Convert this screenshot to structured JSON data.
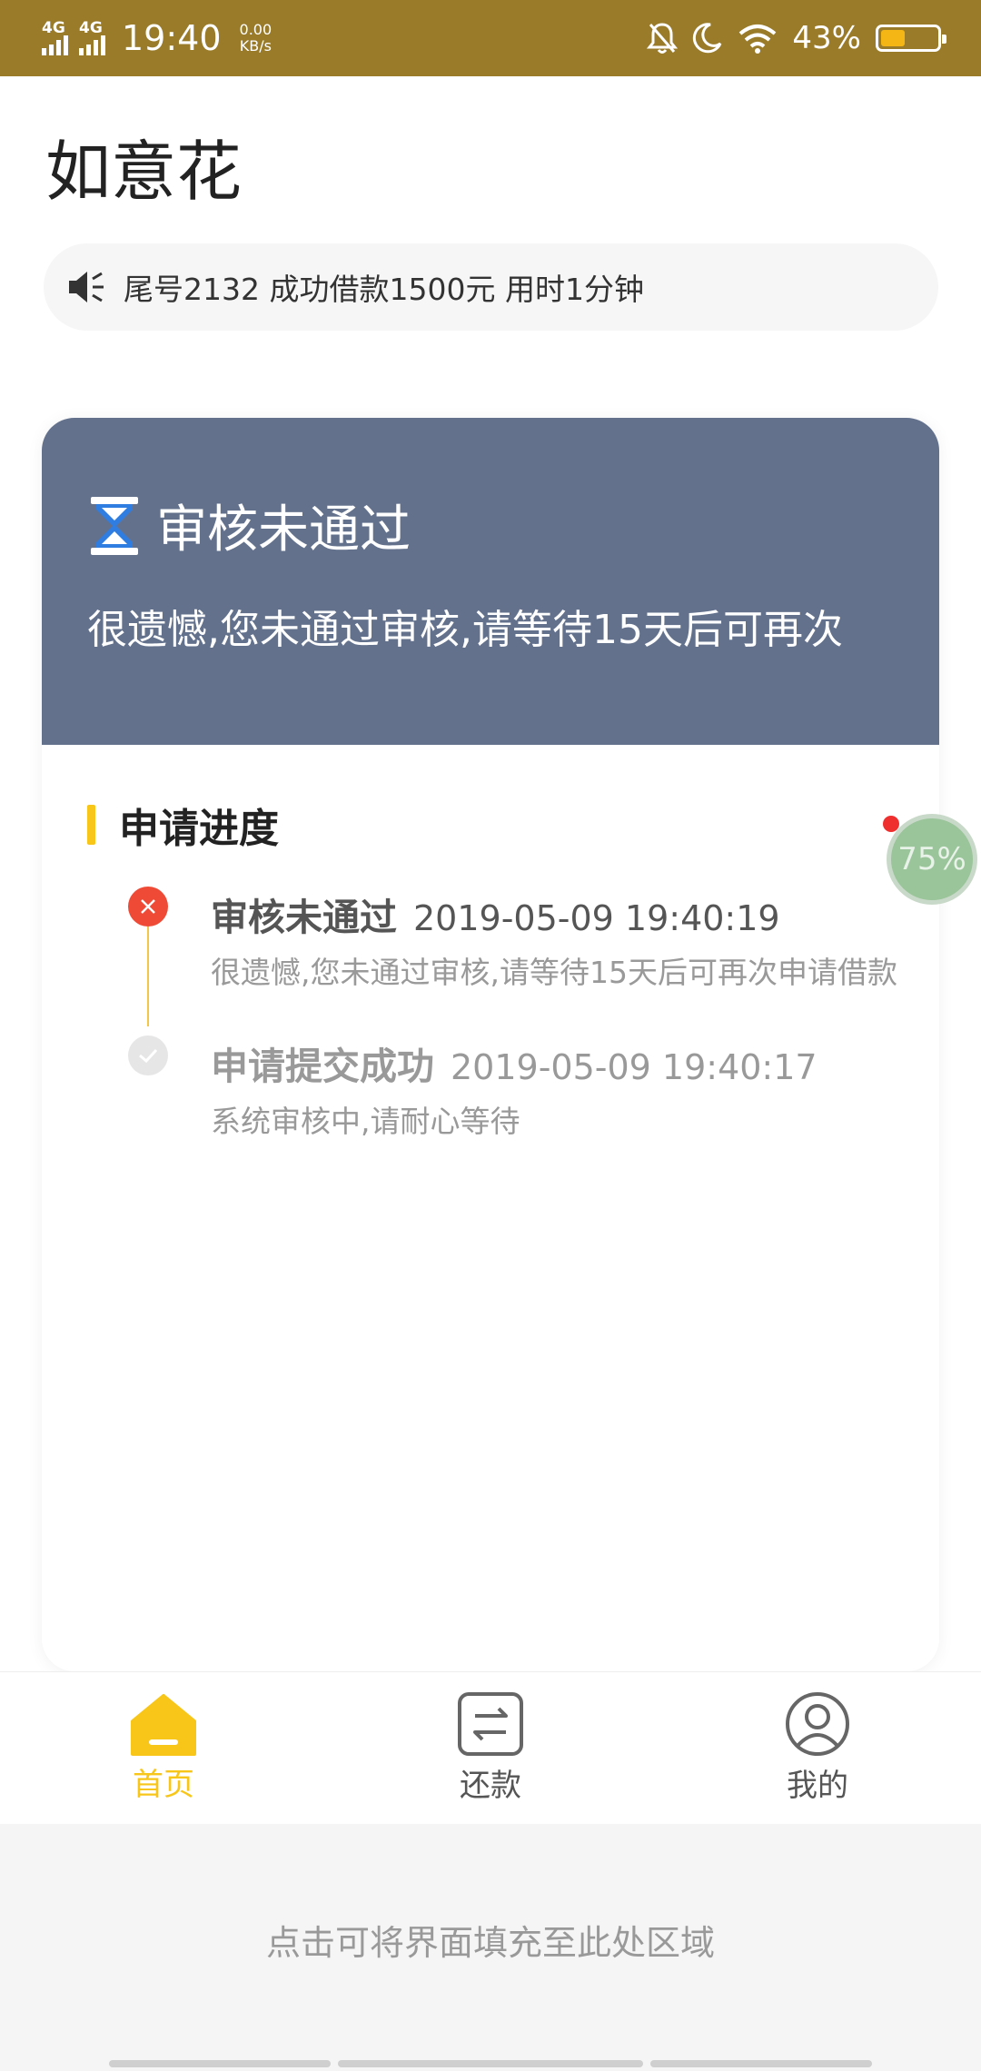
{
  "status_bar": {
    "signal1": "4G",
    "signal2": "4G",
    "time": "19:40",
    "speed_value": "0.00",
    "speed_unit": "KB/s",
    "battery_percent": "43%",
    "battery_level": 0.43,
    "icons": [
      "mute-bell-icon",
      "moon-icon",
      "wifi-icon",
      "battery-icon"
    ]
  },
  "header": {
    "title": "如意花"
  },
  "notice": {
    "icon": "speaker-icon",
    "text": "尾号2132 成功借款1500元 用时1分钟"
  },
  "result_card": {
    "icon": "hourglass-icon",
    "title": "审核未通过",
    "description": "很遗憾,您未通过审核,请等待15天后可再次"
  },
  "progress": {
    "title": "申请进度",
    "items": [
      {
        "status": "审核未通过",
        "time": "2019-05-09 19:40:19",
        "description": "很遗憾,您未通过审核,请等待15天后可再次申请借款",
        "icon": "close-circle-icon"
      },
      {
        "status": "申请提交成功",
        "time": "2019-05-09 19:40:17",
        "description": "系统审核中,请耐心等待",
        "icon": "check-circle-icon"
      }
    ]
  },
  "float_ball": {
    "text": "75%"
  },
  "tabbar": {
    "items": [
      {
        "label": "首页",
        "icon": "home-icon",
        "active": true
      },
      {
        "label": "还款",
        "icon": "repay-icon",
        "active": false
      },
      {
        "label": "我的",
        "icon": "user-icon",
        "active": false
      }
    ]
  },
  "fill_area": {
    "text": "点击可将界面填充至此处区域"
  },
  "colors": {
    "status_bar_bg": "#997b2a",
    "card_header_bg": "#63718d",
    "accent_yellow": "#f7c619",
    "error_red": "#ef4a35"
  }
}
